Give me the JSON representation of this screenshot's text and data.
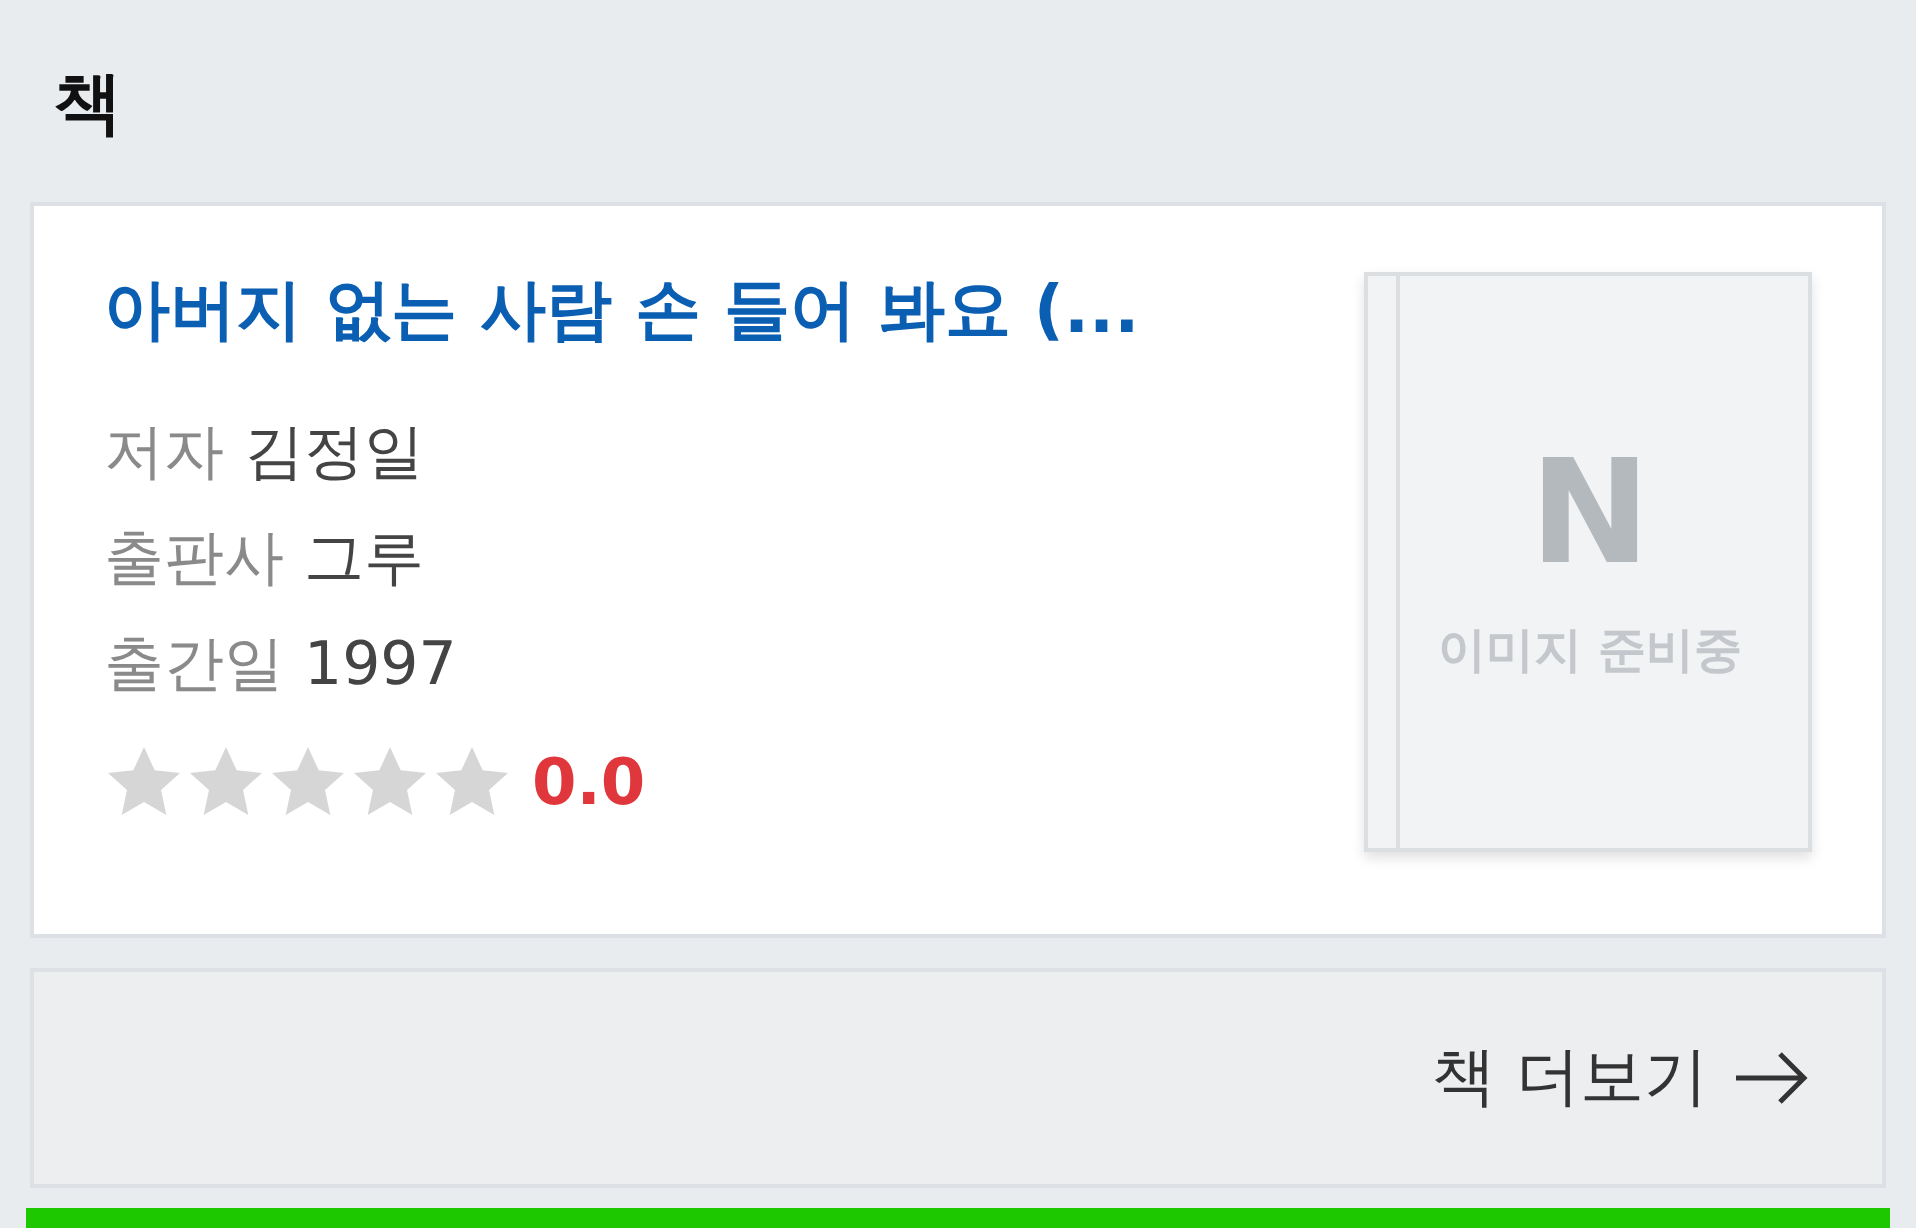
{
  "section_title": "책",
  "book": {
    "title": "아버지 없는 사람 손 들어 봐요 (...",
    "details": [
      {
        "label": "저자",
        "value": "김정일"
      },
      {
        "label": "출판사",
        "value": "그루"
      },
      {
        "label": "출간일",
        "value": "1997"
      }
    ],
    "stars": 0,
    "rating": "0.0",
    "cover": {
      "logo": "N",
      "caption": "이미지 준비중"
    }
  },
  "more_button": "책 더보기"
}
